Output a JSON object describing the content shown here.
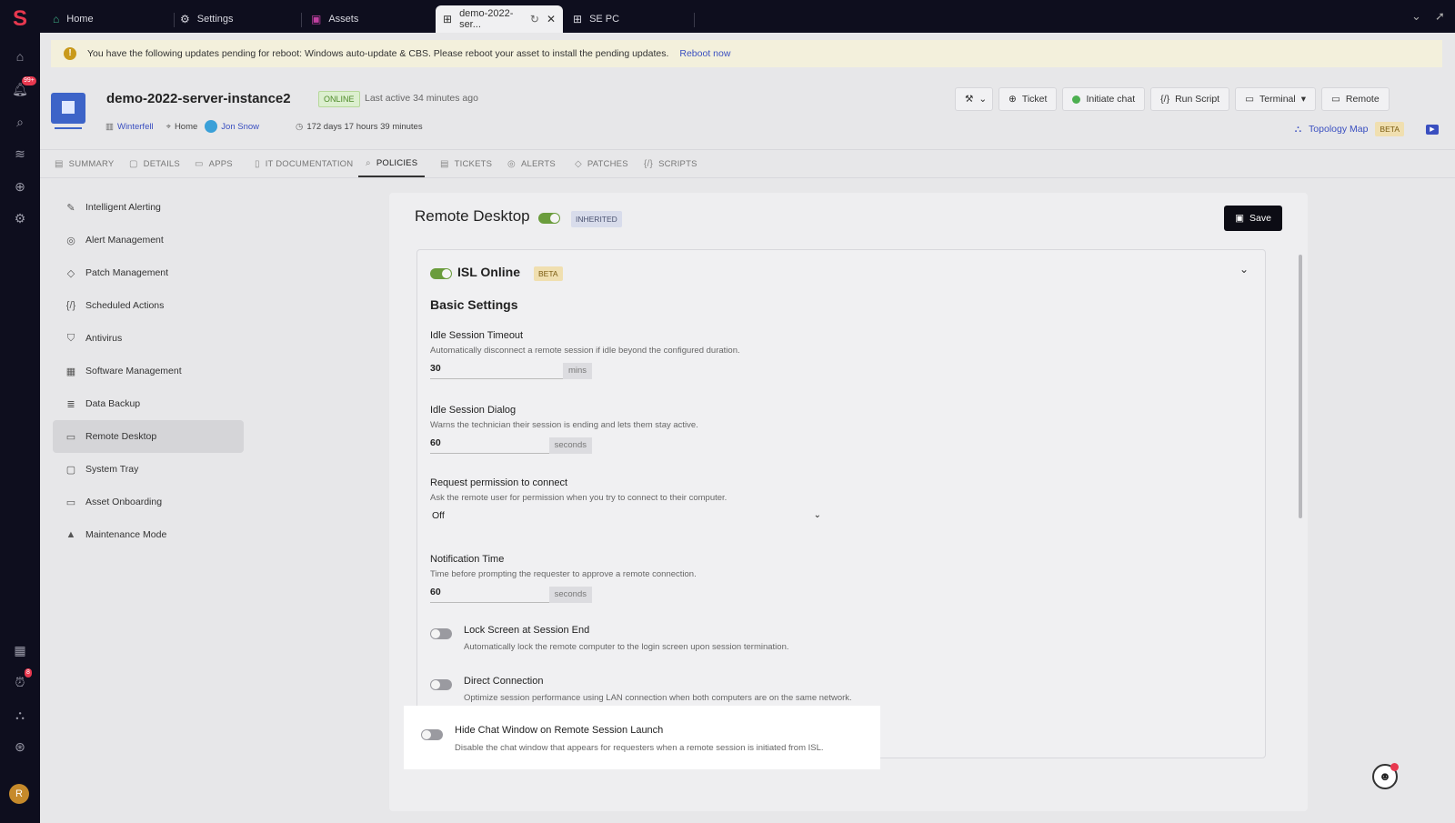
{
  "tabs": [
    {
      "label": "Home",
      "icon": "home-icon"
    },
    {
      "label": "Settings",
      "icon": "gear-icon"
    },
    {
      "label": "Assets",
      "icon": "monitor-icon"
    },
    {
      "label": "demo-2022-ser...",
      "icon": "globe-icon"
    },
    {
      "label": "SE PC",
      "icon": "globe-icon"
    }
  ],
  "rail": {
    "notifications_badge": "99+",
    "alerts_badge": "8",
    "avatar_initial": "R"
  },
  "banner": {
    "text": "You have the following updates pending for reboot: Windows auto-update & CBS. Please reboot your asset to install the pending updates.",
    "link": "Reboot now"
  },
  "asset": {
    "name": "demo-2022-server-instance2",
    "status": "ONLINE",
    "last_active": "Last active 34 minutes ago",
    "site": "Winterfell",
    "location": "Home",
    "user": "Jon Snow",
    "uptime": "172 days 17 hours 39 minutes"
  },
  "actions": {
    "ticket": "Ticket",
    "chat": "Initiate chat",
    "script": "Run Script",
    "terminal": "Terminal",
    "remote": "Remote",
    "topology": "Topology Map",
    "beta": "BETA"
  },
  "subtabs": [
    "SUMMARY",
    "DETAILS",
    "APPS",
    "IT DOCUMENTATION",
    "POLICIES",
    "TICKETS",
    "ALERTS",
    "PATCHES",
    "SCRIPTS"
  ],
  "policy_nav": [
    "Intelligent Alerting",
    "Alert Management",
    "Patch Management",
    "Scheduled Actions",
    "Antivirus",
    "Software Management",
    "Data Backup",
    "Remote Desktop",
    "System Tray",
    "Asset Onboarding",
    "Maintenance Mode"
  ],
  "policy": {
    "title": "Remote Desktop",
    "inherited": "INHERITED",
    "save": "Save",
    "provider": "ISL Online",
    "provider_badge": "BETA",
    "section": "Basic Settings",
    "idle_timeout": {
      "label": "Idle Session Timeout",
      "desc": "Automatically disconnect a remote session if idle beyond the configured duration.",
      "value": "30",
      "unit": "mins"
    },
    "idle_dialog": {
      "label": "Idle Session Dialog",
      "desc": "Warns the technician their session is ending and lets them stay active.",
      "value": "60",
      "unit": "seconds"
    },
    "permission": {
      "label": "Request permission to connect",
      "desc": "Ask the remote user for permission when you try to connect to their computer.",
      "value": "Off"
    },
    "notify_time": {
      "label": "Notification Time",
      "desc": "Time before prompting the requester to approve a remote connection.",
      "value": "60",
      "unit": "seconds"
    },
    "lock_screen": {
      "label": "Lock Screen at Session End",
      "desc": "Automatically lock the remote computer to the login screen upon session termination."
    },
    "direct": {
      "label": "Direct Connection",
      "desc": "Optimize session performance using LAN connection when both computers are on the same network."
    },
    "hide_chat": {
      "label": "Hide Chat Window on Remote Session Launch",
      "desc": "Disable the chat window that appears for requesters when a remote session is initiated from ISL."
    }
  }
}
